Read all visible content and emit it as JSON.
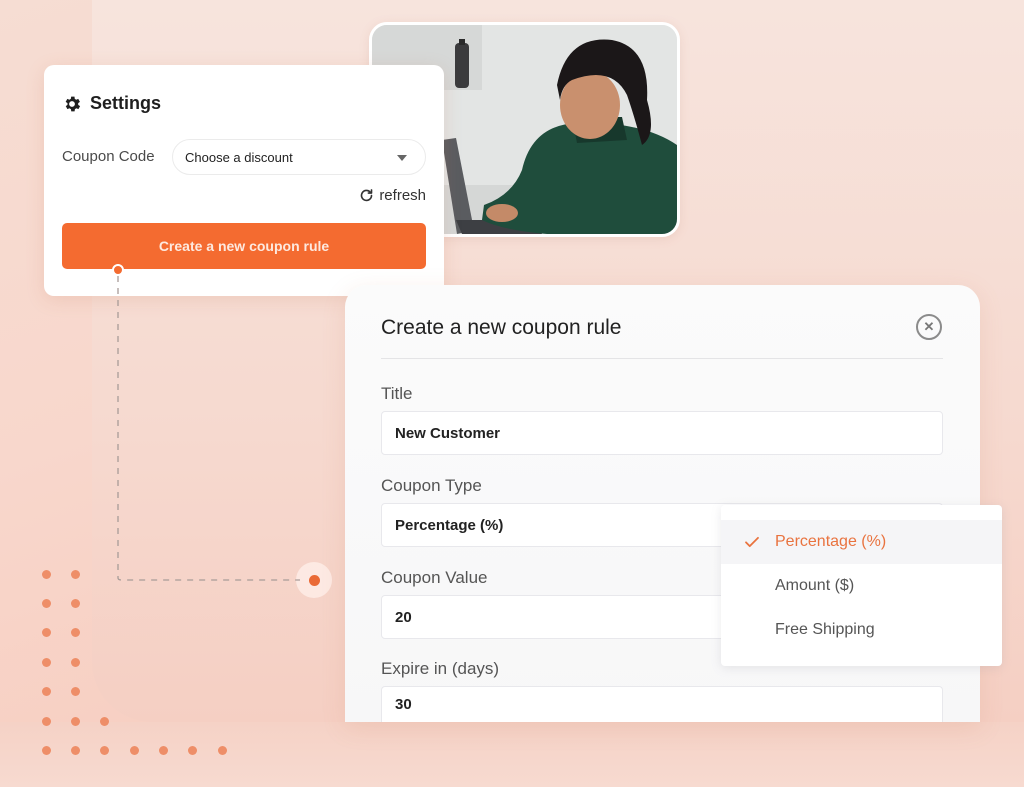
{
  "settings": {
    "title": "Settings",
    "icon": "gear-icon",
    "coupon_code_label": "Coupon Code",
    "coupon_select": {
      "value": "Choose a discount",
      "icon": "caret-down-icon"
    },
    "refresh": {
      "label": "refresh",
      "icon": "refresh-icon"
    },
    "create_button_label": "Create a new coupon rule"
  },
  "photo": {
    "description": "Woman in green turtleneck smiling while typing on a laptop"
  },
  "modal": {
    "title": "Create a new coupon rule",
    "close_icon": "close-circle-icon",
    "fields": [
      {
        "label": "Title",
        "value": "New Customer"
      },
      {
        "label": "Coupon Type",
        "value": "Percentage (%)"
      },
      {
        "label": "Coupon Value",
        "value": "20"
      },
      {
        "label": "Expire in (days)",
        "value": "30"
      }
    ]
  },
  "coupon_type_dropdown": {
    "selected_index": 0,
    "options": [
      {
        "label": "Percentage (%)",
        "selected": true,
        "icon": "check-icon"
      },
      {
        "label": "Amount ($)",
        "selected": false
      },
      {
        "label": "Free Shipping",
        "selected": false
      }
    ]
  },
  "colors": {
    "accent": "#f46b30",
    "accent_text": "#e9733f",
    "dot_pattern": "#ee8e68",
    "background": "#f7d9ce"
  }
}
